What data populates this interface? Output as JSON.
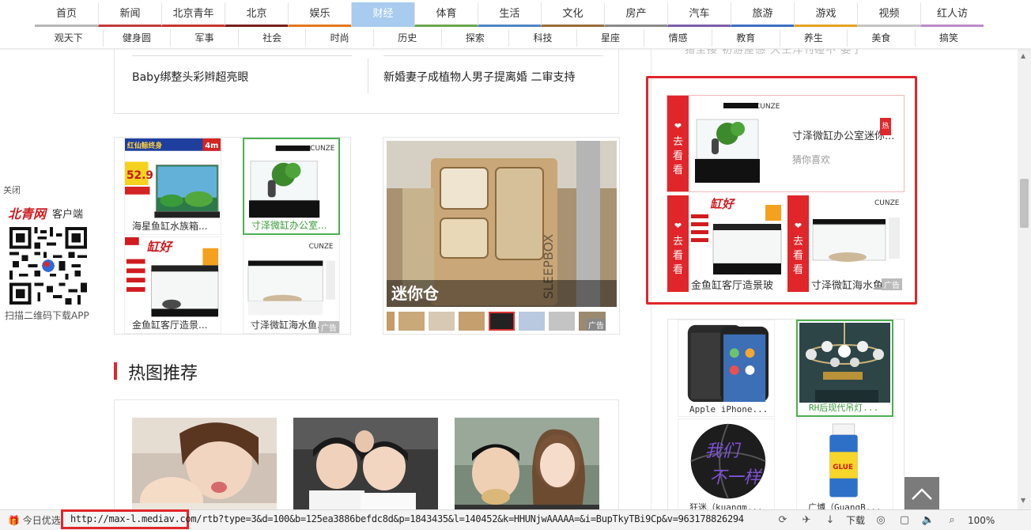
{
  "nav": {
    "row1": [
      "首页",
      "新闻",
      "北京青年",
      "北京",
      "娱乐",
      "财经",
      "体育",
      "生活",
      "文化",
      "房产",
      "汽车",
      "旅游",
      "游戏",
      "视频",
      "红人访"
    ],
    "row1_active": "财经",
    "row1_colors": [
      "#b7b7b7",
      "#c23b3b",
      "#c6362f",
      "#7a1f1f",
      "#e2781c",
      "#a8cbef",
      "#6ba84c",
      "#4f86c6",
      "#9a6b3a",
      "#8a8a8a",
      "#7b5ea8",
      "#3d6ec4",
      "#e3a320",
      "#c4c4c4",
      "#c08acb"
    ],
    "row2": [
      "观天下",
      "健身圆",
      "军事",
      "社会",
      "时尚",
      "历史",
      "探索",
      "科技",
      "星座",
      "情感",
      "教育",
      "养生",
      "美食",
      "搞笑"
    ]
  },
  "qr": {
    "close": "关闭",
    "logo": "北青网",
    "client": "客户端",
    "tip": "扫描二维码下载APP"
  },
  "news": {
    "item1": "Baby绑整头彩辫超亮眼",
    "item2": "新婚妻子成植物人男子提离婚 二审支持"
  },
  "ads_left": {
    "cells": [
      {
        "caption": "海星鱼缸水族箱...",
        "highlight": false
      },
      {
        "caption": "寸泽微缸办公室...",
        "highlight": true
      },
      {
        "caption": "金鱼缸客厅造景...",
        "highlight": false
      },
      {
        "caption": "寸泽微缸海水鱼...",
        "highlight": false
      }
    ],
    "ad_tag": "广告",
    "price": "52.9",
    "brand": "CUNZE"
  },
  "sleep_ad": {
    "title": "迷你仓",
    "ad_tag": "广告",
    "sign": "SLEEPBOX"
  },
  "hot": {
    "title": "热图推荐"
  },
  "right": {
    "top_text": "猎至接 初游屋感   大王洋刊碰不   委了",
    "guess_main": {
      "side": "去看看",
      "title": "寸泽微缸办公室迷你...",
      "sub": "猜你喜欢",
      "hot": "热"
    },
    "guess_small": [
      {
        "side": "去看看",
        "caption": "金鱼缸客厅造景玻"
      },
      {
        "side": "去看看",
        "caption": "寸泽微缸海水鱼缸"
      }
    ],
    "ad_tag": "广告",
    "products": [
      {
        "caption": "Apple iPhone...",
        "highlight": false
      },
      {
        "caption": "RH后现代吊灯...",
        "highlight": true
      },
      {
        "caption": "狂迷（kuangm...",
        "highlight": false
      },
      {
        "caption": "广博（GuangB...",
        "highlight": false
      }
    ]
  },
  "status": {
    "today": "今日优选",
    "url": "http://max-l.mediav.com/rtb?type=3&d=100&b=125ea3886befdc8d&p=1843435&l=140452&k=HHUNjwAAAAA=&i=BupTkyTBi9Cp&v=963178826294",
    "download": "下载",
    "zoom": "100%"
  }
}
